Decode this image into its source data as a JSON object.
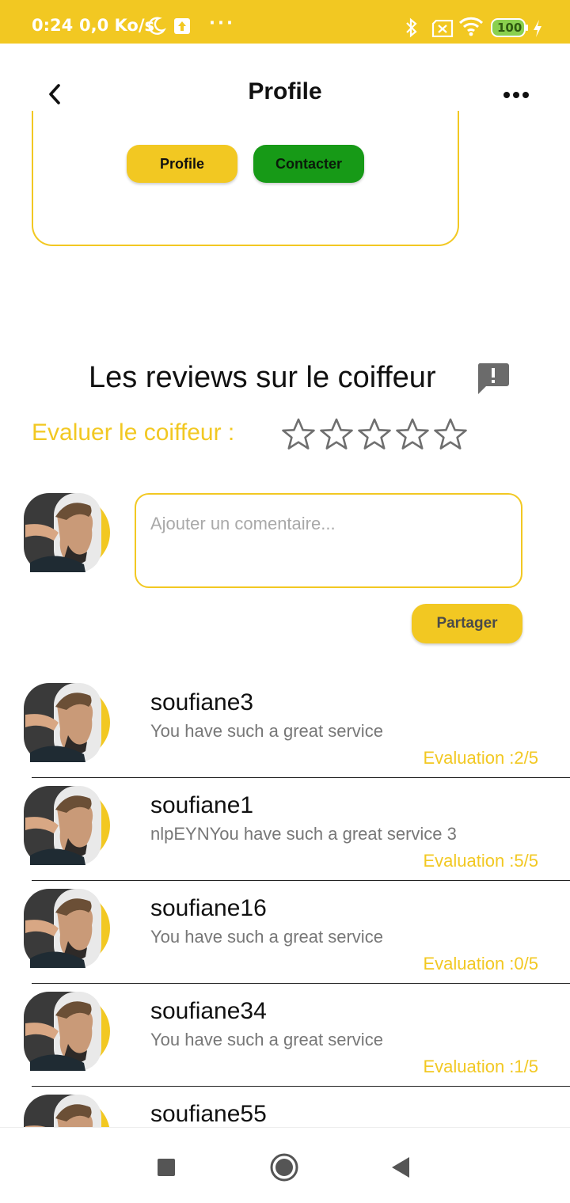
{
  "status_bar": {
    "time": "0:24",
    "speed": "0,0 Ko/s",
    "dots": "···",
    "battery": "100",
    "icons": [
      "moon-icon",
      "upload-icon",
      "bluetooth-icon",
      "sim-x-icon",
      "wifi-icon",
      "battery-icon",
      "charging-icon"
    ]
  },
  "app_bar": {
    "title": "Profile",
    "back_icon": "chevron-left-icon",
    "more_icon": "more-horizontal-icon"
  },
  "card": {
    "profile_label": "Profile",
    "contact_label": "Contacter"
  },
  "reviews": {
    "title": "Les reviews sur le coiffeur",
    "title_icon": "feedback-icon",
    "rate_label": "Evaluer le coiffeur :",
    "star_rating": 0,
    "star_max": 5,
    "comment_placeholder": "Ajouter un comentaire...",
    "comment_value": "",
    "share_label": "Partager",
    "items": [
      {
        "user": "soufiane3",
        "text": "You have such a great service",
        "evaluation": "Evaluation :2/5"
      },
      {
        "user": "soufiane1",
        "text": "nlpEYNYou have such a great service 3",
        "evaluation": "Evaluation :5/5"
      },
      {
        "user": "soufiane16",
        "text": "You have such a great service",
        "evaluation": "Evaluation :0/5"
      },
      {
        "user": "soufiane34",
        "text": "You have such a great service",
        "evaluation": "Evaluation :1/5"
      },
      {
        "user": "soufiane55",
        "text": "",
        "evaluation": ""
      }
    ]
  },
  "nav_bar": {
    "icons": [
      "recents-square-icon",
      "home-circle-icon",
      "back-triangle-icon"
    ]
  },
  "colors": {
    "accent": "#f2c822",
    "contact_green": "#179a17",
    "text_dark": "#111111",
    "text_muted": "#777777"
  }
}
